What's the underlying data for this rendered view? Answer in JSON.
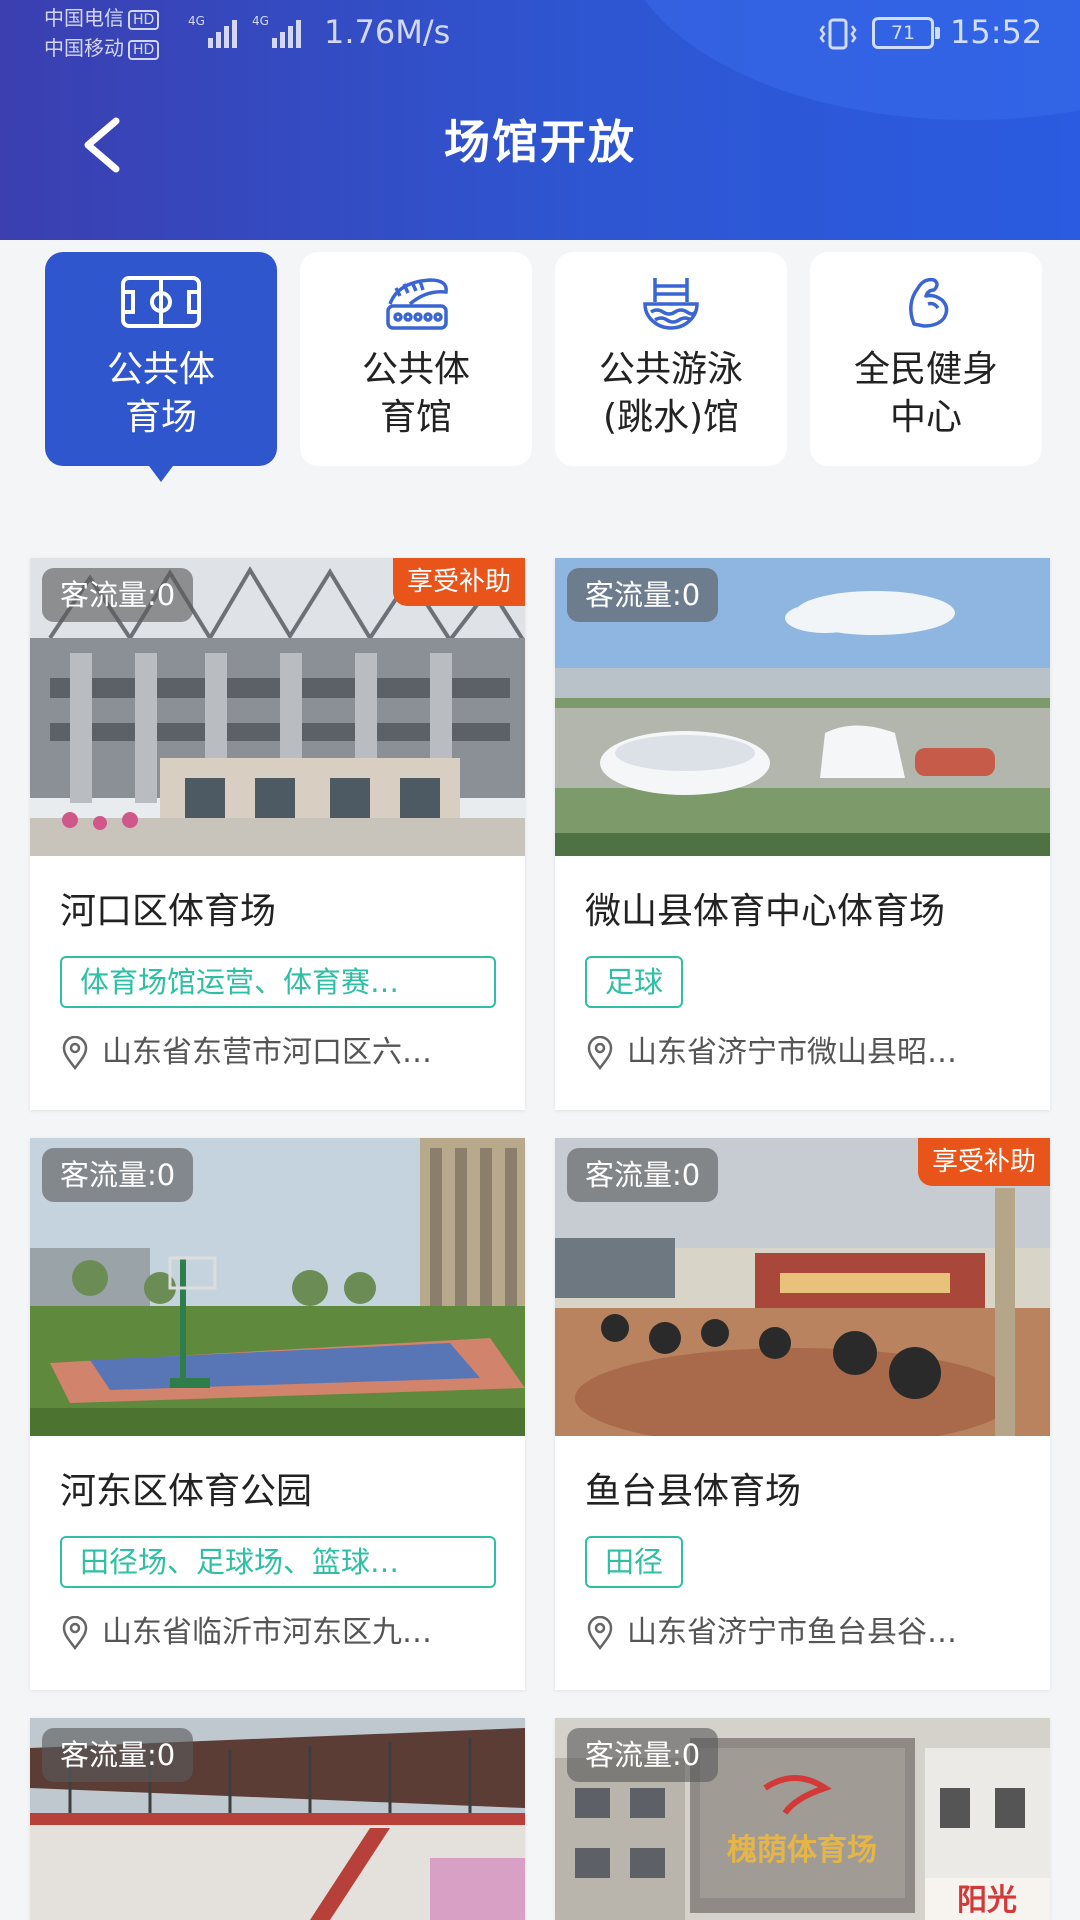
{
  "status_bar": {
    "carrier1": "中国电信",
    "carrier2": "中国移动",
    "hd": "HD",
    "net": "4G",
    "speed": "1.76M/s",
    "battery": "71",
    "time": "15:52"
  },
  "header": {
    "title": "场馆开放"
  },
  "tabs": [
    {
      "line1": "公共体",
      "line2": "育场",
      "icon": "stadium-field-icon"
    },
    {
      "line1": "公共体",
      "line2": "育馆",
      "icon": "gym-building-icon"
    },
    {
      "line1": "公共游泳",
      "line2": "(跳水)馆",
      "icon": "swimming-pool-icon"
    },
    {
      "line1": "全民健身",
      "line2": "中心",
      "icon": "muscle-arm-icon"
    }
  ],
  "active_tab": 0,
  "cards": [
    {
      "flow": "客流量:0",
      "subsidy": "享受补助",
      "name": "河口区体育场",
      "tag": "体育场馆运营、体育赛…",
      "address": "山东省东营市河口区六…"
    },
    {
      "flow": "客流量:0",
      "name": "微山县体育中心体育场",
      "tag": "足球",
      "address": "山东省济宁市微山县昭…"
    },
    {
      "flow": "客流量:0",
      "name": "河东区体育公园",
      "tag": "田径场、足球场、篮球…",
      "address": "山东省临沂市河东区九…"
    },
    {
      "flow": "客流量:0",
      "subsidy": "享受补助",
      "name": "鱼台县体育场",
      "tag": "田径",
      "address": "山东省济宁市鱼台县谷…"
    },
    {
      "flow": "客流量:0"
    },
    {
      "flow": "客流量:0",
      "sign_text": "槐荫体育场",
      "shop_text": "阳光"
    }
  ],
  "colors": {
    "primary": "#2f56cc",
    "tag_teal": "#2fbfa4",
    "subsidy_orange": "#e8541a"
  }
}
